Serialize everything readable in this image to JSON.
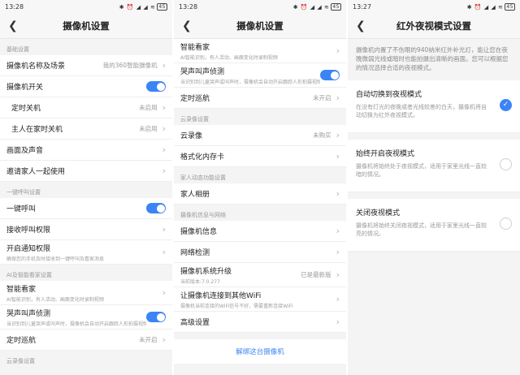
{
  "panel1": {
    "status": {
      "time": "13:28",
      "icons": "✱ ⏰ ◢ ◢ ≋",
      "battery": "45"
    },
    "title": "摄像机设置",
    "sections": {
      "basic": "基础设置",
      "call": "一键呼叫设置",
      "ai": "AI及智能看家设置",
      "cloud": "云录像设置"
    },
    "rows": {
      "name_label": "摄像机名称及场景",
      "name_value": "我的360智能摄像机",
      "switch_label": "摄像机开关",
      "timer_off_label": "定时关机",
      "timer_off_value": "未启用",
      "home_off_label": "主人在家时关机",
      "home_off_value": "未启用",
      "picture_label": "画面及声音",
      "invite_label": "邀请家人一起使用",
      "call_label": "一键呼叫",
      "call_perm_label": "接收呼叫权限",
      "notify_label": "开启通知权限",
      "notify_sub": "确保您的手机及时接收到一键呼叫及看家消息",
      "watch_label": "智能看家",
      "watch_sub": "AI智能识别，有人活动、画面变化时录制视频",
      "cry_label": "哭声叫声侦测",
      "cry_sub": "当识别到儿童哭声或叫声时，摄像机会自动开启跟踪人形拍摄视频",
      "cruise_label": "定时巡航",
      "cruise_value": "未开启"
    }
  },
  "panel2": {
    "status": {
      "time": "13:28",
      "icons": "✱ ⏰ ◢ ◢ ≋",
      "battery": "45"
    },
    "title": "摄像机设置",
    "sections": {
      "cloud": "云录像设置",
      "family": "家人动态功能设置",
      "info": "摄像机信息与网络"
    },
    "rows": {
      "watch_label": "智能看家",
      "watch_sub": "AI智能识别，有人活动、画面变化时录制视频",
      "cry_label": "哭声叫声侦测",
      "cry_sub": "当识别到儿童哭声或叫声时，摄像机会自动开启跟踪人形拍摄视频",
      "cruise_label": "定时巡航",
      "cruise_value": "未开启",
      "cloud_label": "云录像",
      "cloud_value": "未购买",
      "format_label": "格式化内存卡",
      "album_label": "家人相册",
      "camera_info_label": "摄像机信息",
      "network_label": "网络检测",
      "upgrade_label": "摄像机系统升级",
      "upgrade_sub": "当前版本:7.0.277",
      "upgrade_value": "已是最新版",
      "wifi_label": "让摄像机连接到其他WiFi",
      "wifi_sub": "摄像机当前连接的WiFi信号不好，需要重新连接WiFi",
      "advanced_label": "高级设置",
      "unbind_label": "解绑这台摄像机"
    }
  },
  "panel3": {
    "status": {
      "time": "13:27",
      "icons": "✱ ⏰ ◢ ◢ ≋",
      "battery": "45"
    },
    "title": "红外夜视模式设置",
    "description": "摄像机内置了不伤眼的940纳米红外补光灯，能让您在夜晚微弱光线或暗时也能拍摄出清晰的画面。您可以根据您的情况选择合适的夜视模式。",
    "modes": [
      {
        "label": "自动切换到夜视模式",
        "sub": "在没有灯光的夜晚或者光线较差的白天，摄像机将自动切换为红外夜视模式。",
        "checked": true
      },
      {
        "label": "始终开启夜视模式",
        "sub": "摄像机将始终处于夜视模式，适用于家里光线一直较暗的情况。",
        "checked": false
      },
      {
        "label": "关闭夜视模式",
        "sub": "摄像机将始终关闭夜视模式，适用于家里光线一直较亮的情况。",
        "checked": false
      }
    ]
  },
  "icons": {
    "back": "back-arrow-icon",
    "chevron": "chevron-right-icon",
    "check": "checkmark-icon"
  },
  "colors": {
    "accent": "#3b84f5",
    "background": "#f4f4f4"
  }
}
